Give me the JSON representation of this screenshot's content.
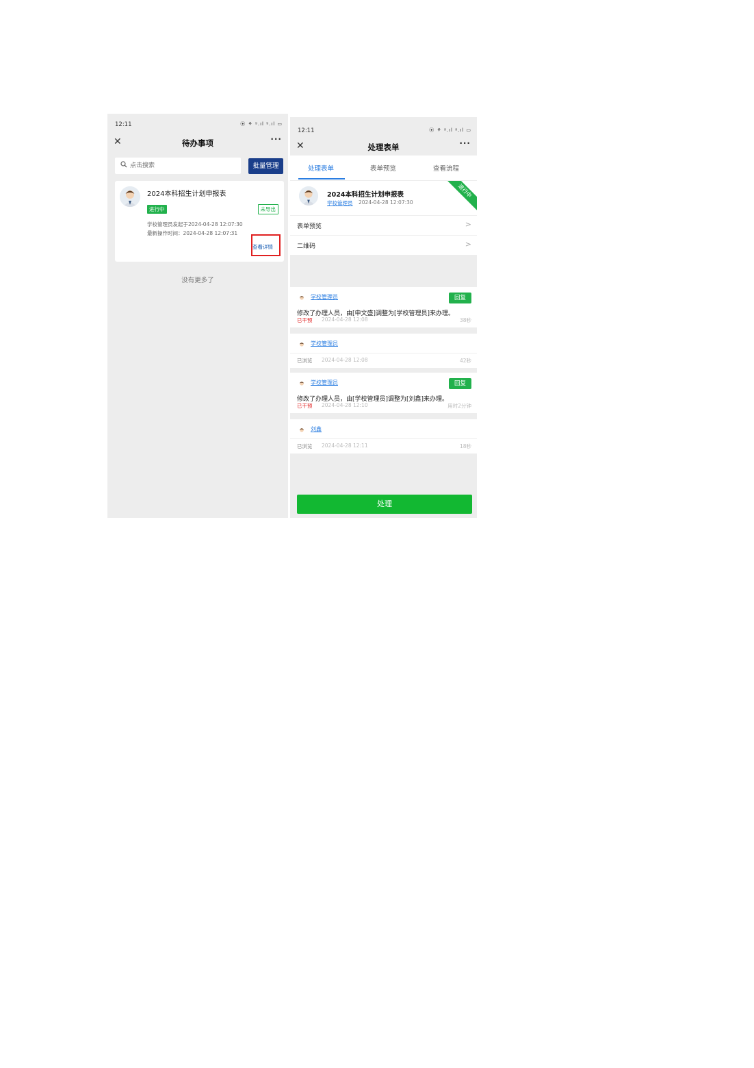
{
  "left_screen": {
    "status_time": "12:11",
    "status_icons": "⦿ ⚘ ᵍ.ıl ᵍ.ıl ▭",
    "title": "待办事项",
    "search_placeholder": "点击搜索",
    "batch_button": "批量管理",
    "card": {
      "title": "2024本科招生计划申报表",
      "status": "进行中",
      "export_status": "未导出",
      "initiated": "学校管理员发起于2024-04-28 12:07:30",
      "last_operation": "最新操作时间：2024-04-28 12:07:31",
      "detail_link": "查看详情"
    },
    "no_more": "没有更多了"
  },
  "right_screen": {
    "status_time": "12:11",
    "status_icons": "⦿ ⚘ ᵍ.ıl ᵍ.ıl ▭",
    "title": "处理表单",
    "tabs": [
      "处理表单",
      "表单预览",
      "查看流程"
    ],
    "form": {
      "title": "2024本科招生计划申报表",
      "user": "学校管理员",
      "date": "2024-04-28 12:07:30",
      "ribbon": "进行中"
    },
    "menu": [
      "表单预览",
      "二维码"
    ],
    "logs": [
      {
        "user": "学校管理员",
        "reply": "回复",
        "message": "修改了办理人员，由[申文盛]调整为[学校管理员]来办理。",
        "tag": "已干预",
        "time": "2024-04-28 12:08",
        "duration": "38秒"
      },
      {
        "user": "学校管理员",
        "tag": "已浏览",
        "time": "2024-04-28 12:08",
        "duration": "42秒"
      },
      {
        "user": "学校管理员",
        "reply": "回复",
        "message": "修改了办理人员，由[学校管理员]调整为[刘鑫]来办理。",
        "tag": "已干预",
        "time": "2024-04-28 12:10",
        "duration": "用时2分钟"
      },
      {
        "user": "刘鑫",
        "tag": "已浏览",
        "time": "2024-04-28 12:11",
        "duration": "18秒"
      }
    ],
    "process_button": "处理"
  },
  "colors": {
    "accent_blue": "#2a7de1",
    "nav_blue": "#1a3e8a",
    "green": "#22b14c",
    "red": "#e02020"
  },
  "icons": [
    "close-icon",
    "more-icon",
    "search-icon",
    "avatar-icon",
    "chevron-right-icon"
  ]
}
